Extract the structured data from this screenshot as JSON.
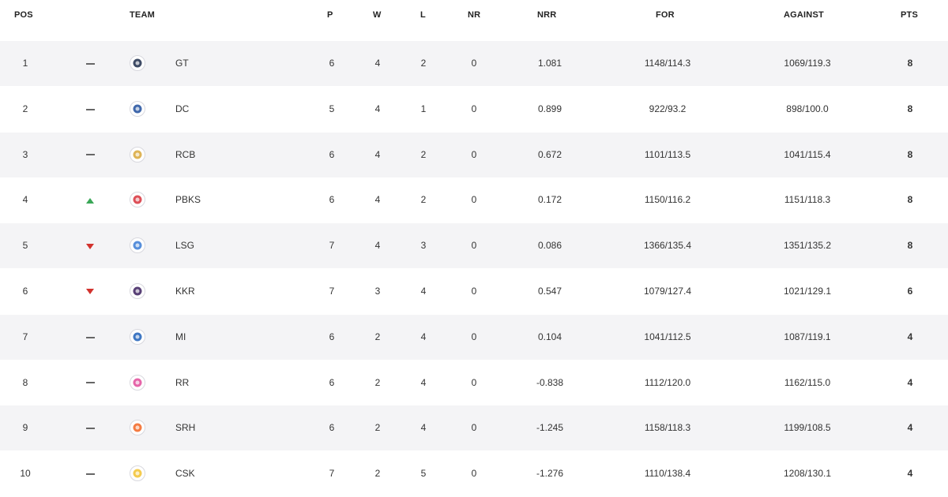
{
  "headers": {
    "pos": "POS",
    "team": "TEAM",
    "p": "P",
    "w": "W",
    "l": "L",
    "nr": "NR",
    "nrr": "NRR",
    "for": "FOR",
    "against": "AGAINST",
    "pts": "PTS"
  },
  "colors": {
    "row_bg": "#f4f4f6",
    "up": "#3aa757",
    "down": "#d2322d"
  },
  "rows": [
    {
      "pos": "1",
      "movement": "same",
      "logo_icon": "gt-logo-icon",
      "logo_color": "#1c2b4a",
      "team": "GT",
      "p": "6",
      "w": "4",
      "l": "2",
      "nr": "0",
      "nrr": "1.081",
      "for": "1148/114.3",
      "against": "1069/119.3",
      "pts": "8"
    },
    {
      "pos": "2",
      "movement": "same",
      "logo_icon": "dc-logo-icon",
      "logo_color": "#1f4e9c",
      "team": "DC",
      "p": "5",
      "w": "4",
      "l": "1",
      "nr": "0",
      "nrr": "0.899",
      "for": "922/93.2",
      "against": "898/100.0",
      "pts": "8"
    },
    {
      "pos": "3",
      "movement": "same",
      "logo_icon": "rcb-logo-icon",
      "logo_color": "#d8a73a",
      "team": "RCB",
      "p": "6",
      "w": "4",
      "l": "2",
      "nr": "0",
      "nrr": "0.672",
      "for": "1101/113.5",
      "against": "1041/115.4",
      "pts": "8"
    },
    {
      "pos": "4",
      "movement": "up",
      "logo_icon": "pbks-logo-icon",
      "logo_color": "#d7313b",
      "team": "PBKS",
      "p": "6",
      "w": "4",
      "l": "2",
      "nr": "0",
      "nrr": "0.172",
      "for": "1150/116.2",
      "against": "1151/118.3",
      "pts": "8"
    },
    {
      "pos": "5",
      "movement": "down",
      "logo_icon": "lsg-logo-icon",
      "logo_color": "#3a7bd5",
      "team": "LSG",
      "p": "7",
      "w": "4",
      "l": "3",
      "nr": "0",
      "nrr": "0.086",
      "for": "1366/135.4",
      "against": "1351/135.2",
      "pts": "8"
    },
    {
      "pos": "6",
      "movement": "down",
      "logo_icon": "kkr-logo-icon",
      "logo_color": "#3b1f5e",
      "team": "KKR",
      "p": "7",
      "w": "3",
      "l": "4",
      "nr": "0",
      "nrr": "0.547",
      "for": "1079/127.4",
      "against": "1021/129.1",
      "pts": "6"
    },
    {
      "pos": "7",
      "movement": "same",
      "logo_icon": "mi-logo-icon",
      "logo_color": "#1d5fb8",
      "team": "MI",
      "p": "6",
      "w": "2",
      "l": "4",
      "nr": "0",
      "nrr": "0.104",
      "for": "1041/112.5",
      "against": "1087/119.1",
      "pts": "4"
    },
    {
      "pos": "8",
      "movement": "same",
      "logo_icon": "rr-logo-icon",
      "logo_color": "#e04a9a",
      "team": "RR",
      "p": "6",
      "w": "2",
      "l": "4",
      "nr": "0",
      "nrr": "-0.838",
      "for": "1112/120.0",
      "against": "1162/115.0",
      "pts": "4"
    },
    {
      "pos": "9",
      "movement": "same",
      "logo_icon": "srh-logo-icon",
      "logo_color": "#f26522",
      "team": "SRH",
      "p": "6",
      "w": "2",
      "l": "4",
      "nr": "0",
      "nrr": "-1.245",
      "for": "1158/118.3",
      "against": "1199/108.5",
      "pts": "4"
    },
    {
      "pos": "10",
      "movement": "same",
      "logo_icon": "csk-logo-icon",
      "logo_color": "#f2c230",
      "team": "CSK",
      "p": "7",
      "w": "2",
      "l": "5",
      "nr": "0",
      "nrr": "-1.276",
      "for": "1110/138.4",
      "against": "1208/130.1",
      "pts": "4"
    }
  ]
}
